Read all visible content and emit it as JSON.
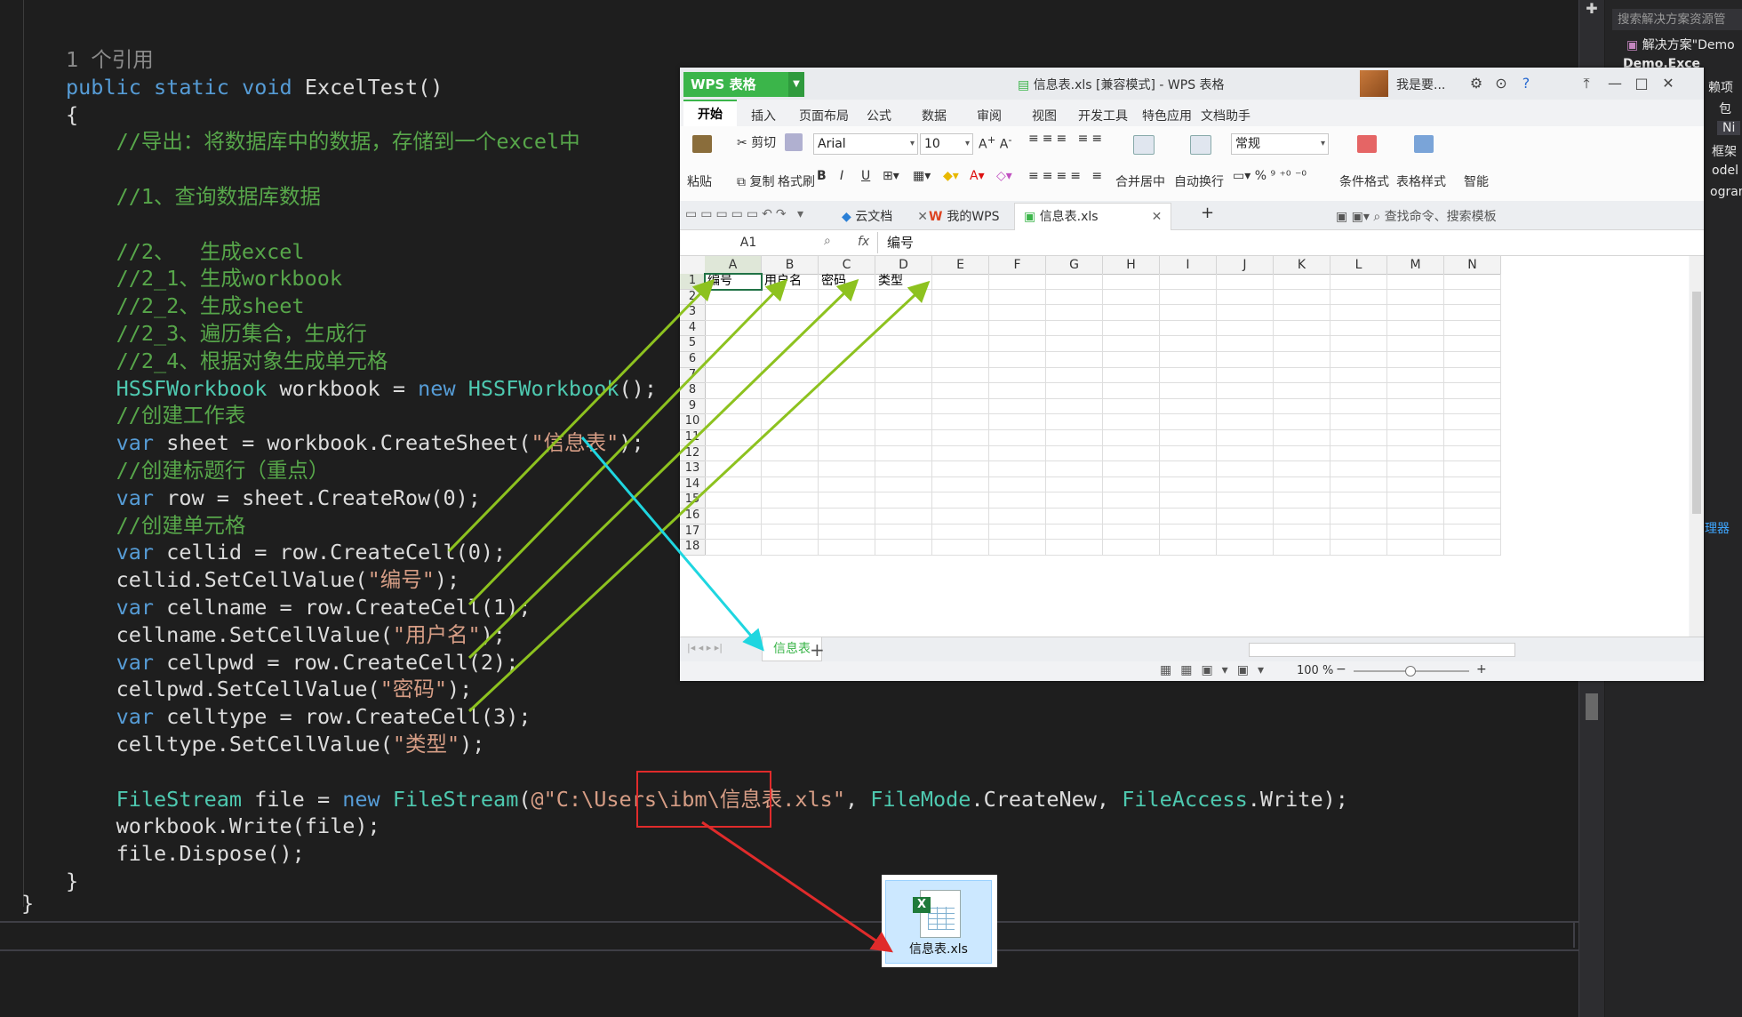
{
  "editor": {
    "lines": [
      {
        "segs": [
          {
            "t": "1 个引用",
            "c": "gray"
          }
        ]
      },
      {
        "segs": [
          {
            "t": "public static void ",
            "c": "kw"
          },
          {
            "t": "ExcelTest()",
            "c": ""
          }
        ]
      },
      {
        "segs": [
          {
            "t": "{",
            "c": ""
          }
        ]
      },
      {
        "segs": [
          {
            "t": "    //导出：将数据库中的数据，存储到一个excel中",
            "c": "cm"
          }
        ]
      },
      {
        "segs": [
          {
            "t": "",
            "c": ""
          }
        ]
      },
      {
        "segs": [
          {
            "t": "    //1、查询数据库数据",
            "c": "cm"
          }
        ]
      },
      {
        "segs": [
          {
            "t": "",
            "c": ""
          }
        ]
      },
      {
        "segs": [
          {
            "t": "    //2、  生成excel",
            "c": "cm"
          }
        ]
      },
      {
        "segs": [
          {
            "t": "    //2_1、生成workbook",
            "c": "cm"
          }
        ]
      },
      {
        "segs": [
          {
            "t": "    //2_2、生成sheet",
            "c": "cm"
          }
        ]
      },
      {
        "segs": [
          {
            "t": "    //2_3、遍历集合，生成行",
            "c": "cm"
          }
        ]
      },
      {
        "segs": [
          {
            "t": "    //2_4、根据对象生成单元格",
            "c": "cm"
          }
        ]
      },
      {
        "segs": [
          {
            "t": "    ",
            "c": ""
          },
          {
            "t": "HSSFWorkbook",
            "c": "ty"
          },
          {
            "t": " workbook = ",
            "c": ""
          },
          {
            "t": "new ",
            "c": "kw"
          },
          {
            "t": "HSSFWorkbook",
            "c": "ty"
          },
          {
            "t": "();",
            "c": ""
          }
        ]
      },
      {
        "segs": [
          {
            "t": "    //创建工作表",
            "c": "cm"
          }
        ]
      },
      {
        "segs": [
          {
            "t": "    ",
            "c": ""
          },
          {
            "t": "var",
            "c": "kw"
          },
          {
            "t": " sheet = workbook.CreateSheet(",
            "c": ""
          },
          {
            "t": "\"信息表\"",
            "c": "st"
          },
          {
            "t": ");",
            "c": ""
          }
        ]
      },
      {
        "segs": [
          {
            "t": "    //创建标题行（重点）",
            "c": "cm"
          }
        ]
      },
      {
        "segs": [
          {
            "t": "    ",
            "c": ""
          },
          {
            "t": "var",
            "c": "kw"
          },
          {
            "t": " row = sheet.CreateRow(0);",
            "c": ""
          }
        ]
      },
      {
        "segs": [
          {
            "t": "    //创建单元格",
            "c": "cm"
          }
        ]
      },
      {
        "segs": [
          {
            "t": "    ",
            "c": ""
          },
          {
            "t": "var",
            "c": "kw"
          },
          {
            "t": " cellid = row.CreateCell(0);",
            "c": ""
          }
        ]
      },
      {
        "segs": [
          {
            "t": "    cellid.SetCellValue(",
            "c": ""
          },
          {
            "t": "\"编号\"",
            "c": "st"
          },
          {
            "t": ");",
            "c": ""
          }
        ]
      },
      {
        "segs": [
          {
            "t": "    ",
            "c": ""
          },
          {
            "t": "var",
            "c": "kw"
          },
          {
            "t": " cellname = row.CreateCell(1);",
            "c": ""
          }
        ]
      },
      {
        "segs": [
          {
            "t": "    cellname.SetCellValue(",
            "c": ""
          },
          {
            "t": "\"用户名\"",
            "c": "st"
          },
          {
            "t": ");",
            "c": ""
          }
        ]
      },
      {
        "segs": [
          {
            "t": "    ",
            "c": ""
          },
          {
            "t": "var",
            "c": "kw"
          },
          {
            "t": " cellpwd = row.CreateCell(2);",
            "c": ""
          }
        ]
      },
      {
        "segs": [
          {
            "t": "    cellpwd.SetCellValue(",
            "c": ""
          },
          {
            "t": "\"密码\"",
            "c": "st"
          },
          {
            "t": ");",
            "c": ""
          }
        ]
      },
      {
        "segs": [
          {
            "t": "    ",
            "c": ""
          },
          {
            "t": "var",
            "c": "kw"
          },
          {
            "t": " celltype = row.CreateCell(3);",
            "c": ""
          }
        ]
      },
      {
        "segs": [
          {
            "t": "    celltype.SetCellValue(",
            "c": ""
          },
          {
            "t": "\"类型\"",
            "c": "st"
          },
          {
            "t": ");",
            "c": ""
          }
        ]
      },
      {
        "segs": [
          {
            "t": "",
            "c": ""
          }
        ]
      },
      {
        "segs": [
          {
            "t": "    ",
            "c": ""
          },
          {
            "t": "FileStream",
            "c": "ty"
          },
          {
            "t": " file = ",
            "c": ""
          },
          {
            "t": "new ",
            "c": "kw"
          },
          {
            "t": "FileStream",
            "c": "ty"
          },
          {
            "t": "(",
            "c": ""
          },
          {
            "t": "@\"C:\\Users\\ibm\\信息表.xls\"",
            "c": "st"
          },
          {
            "t": ", ",
            "c": ""
          },
          {
            "t": "FileMode",
            "c": "ty"
          },
          {
            "t": ".CreateNew, ",
            "c": ""
          },
          {
            "t": "FileAccess",
            "c": "ty"
          },
          {
            "t": ".Write);",
            "c": ""
          }
        ]
      },
      {
        "segs": [
          {
            "t": "    workbook.Write(file);",
            "c": ""
          }
        ]
      },
      {
        "segs": [
          {
            "t": "    file.Dispose();",
            "c": ""
          }
        ]
      },
      {
        "segs": [
          {
            "t": "}",
            "c": ""
          }
        ]
      }
    ],
    "closing_brace": "}"
  },
  "solution": {
    "search_placeholder": "搜索解决方案资源管",
    "items": [
      "解决方案\"Demo",
      "Demo.Exce",
      "赖项",
      "包",
      "Ni",
      "框架",
      "odel",
      "ogram",
      "理器"
    ]
  },
  "wps": {
    "logo": "WPS 表格",
    "title": "信息表.xls [兼容模式] - WPS 表格",
    "username": "我是要...",
    "tabs": [
      "开始",
      "插入",
      "页面布局",
      "公式",
      "数据",
      "审阅",
      "视图",
      "开发工具",
      "特色应用",
      "文档助手"
    ],
    "ribbon": {
      "paste": "粘贴",
      "cut": "剪切",
      "copy": "复制",
      "format_painter": "格式刷",
      "font": "Arial",
      "size": "10",
      "merge": "合并居中",
      "wrap": "自动换行",
      "number_format": "常规",
      "cond_format": "条件格式",
      "table_style": "表格样式",
      "smart": "智能"
    },
    "doc_tabs": [
      "云文档",
      "我的WPS",
      "信息表.xls"
    ],
    "search_cmd": "查找命令、搜索模板",
    "namebox": "A1",
    "formula_value": "编号",
    "columns": [
      "A",
      "B",
      "C",
      "D",
      "E",
      "F",
      "G",
      "H",
      "I",
      "J",
      "K",
      "L",
      "M",
      "N"
    ],
    "rows": [
      "1",
      "2",
      "3",
      "4",
      "5",
      "6",
      "7",
      "8",
      "9",
      "10",
      "11",
      "12",
      "13",
      "14",
      "15",
      "16",
      "17",
      "18"
    ],
    "cells": [
      "编号",
      "用户名",
      "密码",
      "类型"
    ],
    "sheet_tab": "信息表",
    "zoom": "100 %"
  },
  "file": {
    "name": "信息表.xls"
  }
}
